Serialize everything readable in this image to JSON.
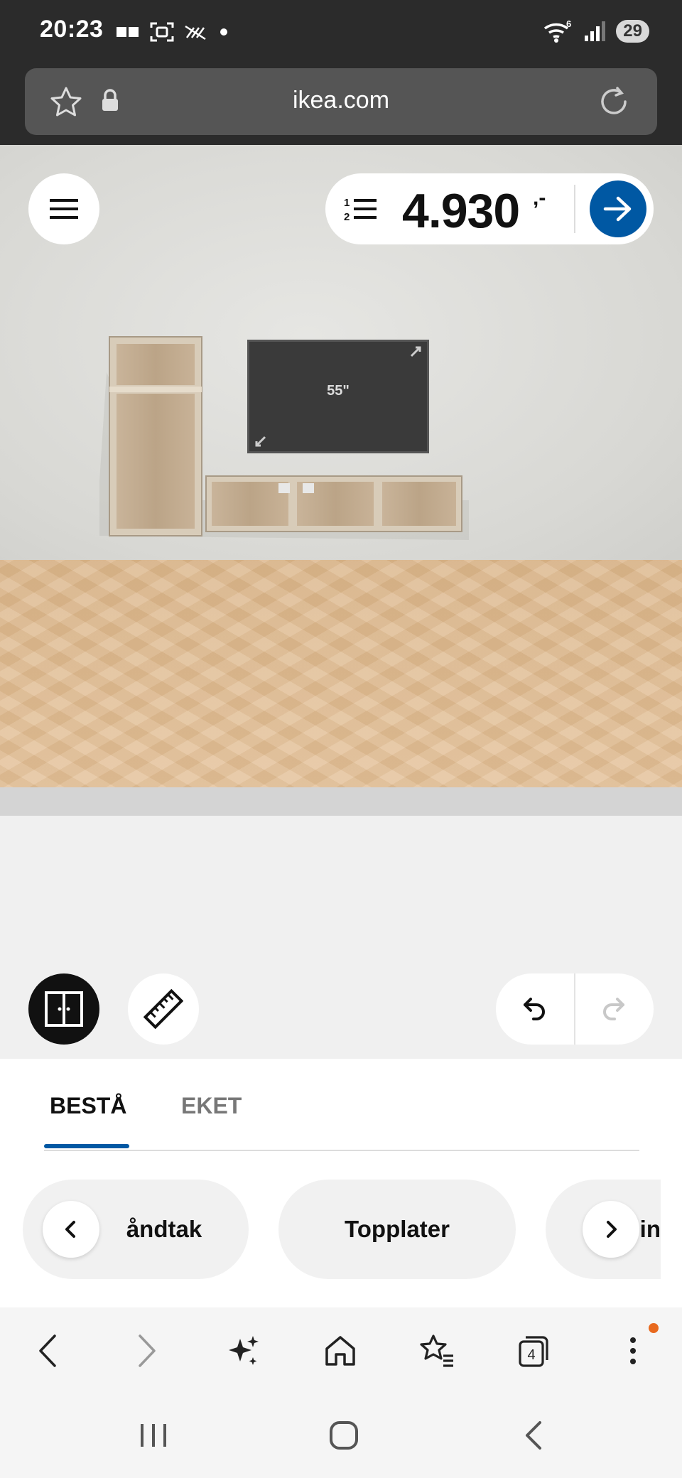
{
  "status_bar": {
    "time": "20:23",
    "battery": "29",
    "wifi_badge": "6"
  },
  "browser": {
    "url": "ikea.com",
    "tab_count": "4"
  },
  "planner": {
    "price": "4.930",
    "price_suffix": ",-",
    "tv_label": "55\""
  },
  "tabs": [
    {
      "label": "BESTÅ",
      "active": true
    },
    {
      "label": "EKET",
      "active": false
    }
  ],
  "chips": [
    {
      "label": "åndtak"
    },
    {
      "label": "Topplater"
    },
    {
      "label": "in"
    }
  ],
  "icons": {
    "menu": "hamburger-icon",
    "list": "numbered-list-icon",
    "go": "arrow-right-icon",
    "doors": "doors-icon",
    "ruler": "ruler-icon",
    "undo": "undo-icon",
    "redo": "redo-icon"
  },
  "colors": {
    "accent": "#0058a3",
    "status_bg": "#2b2b2b",
    "notify": "#e8691e"
  }
}
